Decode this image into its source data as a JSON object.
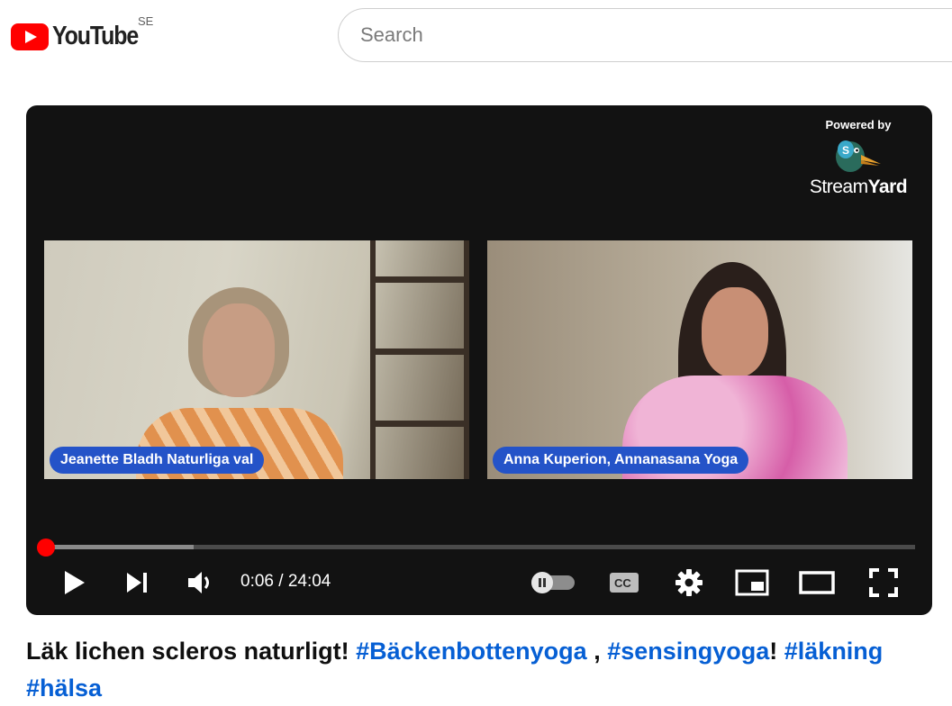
{
  "header": {
    "logo_text": "YouTube",
    "country_code": "SE",
    "search": {
      "placeholder": "Search",
      "value": ""
    }
  },
  "player": {
    "overlay": {
      "powered_by": "Powered by",
      "brand_part1": "Stream",
      "brand_part2": "Yard"
    },
    "participants": [
      {
        "name": "Jeanette Bladh Naturliga val"
      },
      {
        "name": "Anna Kuperion, Annanasana Yoga"
      }
    ],
    "current_time": "0:06",
    "time_separator": " / ",
    "duration": "24:04",
    "progress_fraction": 0.004,
    "controls": {
      "play": "play-icon",
      "next": "next-icon",
      "volume": "volume-icon",
      "autoplay": "autoplay-toggle-icon",
      "captions": "captions-icon",
      "settings": "gear-icon",
      "miniplayer": "miniplayer-icon",
      "theater": "theater-icon",
      "fullscreen": "fullscreen-icon"
    },
    "accent_color": "#ff0000",
    "nametag_color": "#2453c8"
  },
  "video": {
    "title_text": "Läk lichen scleros naturligt! ",
    "hashtags": [
      "#Bäckenbottenyoga",
      "#sensingyoga",
      "#läkning",
      "#hälsa"
    ],
    "separators": [
      " , ",
      "! "
    ]
  }
}
